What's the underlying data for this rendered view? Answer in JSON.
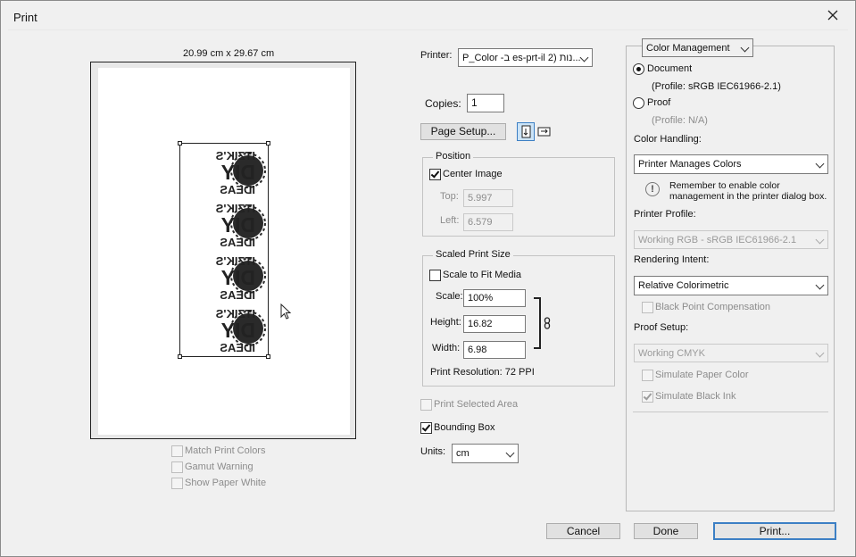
{
  "window": {
    "title": "Print"
  },
  "preview": {
    "size_label": "20.99 cm x 29.67 cm",
    "match_print_colors": "Match Print Colors",
    "gamut_warning": "Gamut Warning",
    "show_paper_white": "Show Paper White",
    "logo_lines": [
      "ITZIK'S",
      "DIY",
      "IDEAS"
    ]
  },
  "printer": {
    "label": "Printer:",
    "value": "P_Color -ב es-prt-il 2) נות..."
  },
  "copies": {
    "label": "Copies:",
    "value": "1"
  },
  "page_setup": {
    "label": "Page Setup..."
  },
  "position": {
    "title": "Position",
    "center_image": "Center Image",
    "top_label": "Top:",
    "top_value": "5.997",
    "left_label": "Left:",
    "left_value": "6.579"
  },
  "scaled": {
    "title": "Scaled Print Size",
    "scale_to_fit": "Scale to Fit Media",
    "scale_label": "Scale:",
    "scale_value": "100%",
    "height_label": "Height:",
    "height_value": "16.82",
    "width_label": "Width:",
    "width_value": "6.98",
    "resolution": "Print Resolution: 72 PPI"
  },
  "print_selected_area": "Print Selected Area",
  "bounding_box": "Bounding Box",
  "units": {
    "label": "Units:",
    "value": "cm"
  },
  "color": {
    "section": "Color Management",
    "document": "Document",
    "document_profile": "(Profile: sRGB IEC61966-2.1)",
    "proof": "Proof",
    "proof_profile": "(Profile: N/A)",
    "handling_label": "Color Handling:",
    "handling_value": "Printer Manages Colors",
    "reminder": "Remember to enable color management in the printer dialog box.",
    "profile_label": "Printer Profile:",
    "profile_value": "Working RGB - sRGB IEC61966-2.1",
    "intent_label": "Rendering Intent:",
    "intent_value": "Relative Colorimetric",
    "bpc": "Black Point Compensation",
    "proof_setup_label": "Proof Setup:",
    "proof_setup_value": "Working CMYK",
    "sim_paper": "Simulate Paper Color",
    "sim_ink": "Simulate Black Ink"
  },
  "buttons": {
    "cancel": "Cancel",
    "done": "Done",
    "print": "Print..."
  },
  "icons": {
    "close": "close-icon",
    "portrait": "portrait-orientation-icon",
    "landscape": "landscape-orientation-icon",
    "link": "chain-link-icon",
    "info": "info-icon",
    "cursor": "cursor-pointer-icon"
  },
  "colors": {
    "accent": "#3c7fc4"
  }
}
